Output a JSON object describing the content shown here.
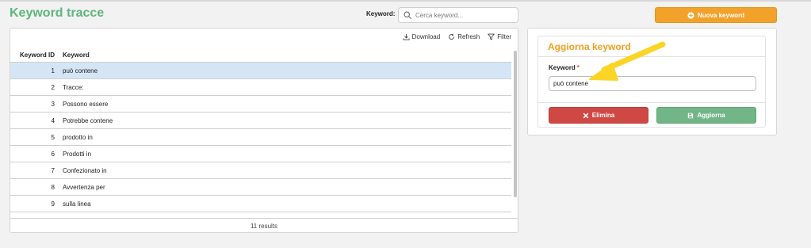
{
  "page": {
    "title": "Keyword tracce"
  },
  "search": {
    "label": "Keyword:",
    "placeholder": "Cerca keyword...",
    "value": ""
  },
  "toolbar": {
    "download_label": "Download",
    "refresh_label": "Refresh",
    "filter_label": "Filter"
  },
  "table": {
    "columns": [
      "Keyword ID",
      "Keyword"
    ],
    "selected_id": 1,
    "rows": [
      {
        "id": "1",
        "keyword": "può contene"
      },
      {
        "id": "2",
        "keyword": "Tracce:"
      },
      {
        "id": "3",
        "keyword": "Possono essere"
      },
      {
        "id": "4",
        "keyword": "Potrebbe contene"
      },
      {
        "id": "5",
        "keyword": "prodotto in"
      },
      {
        "id": "6",
        "keyword": "Prodotti in"
      },
      {
        "id": "7",
        "keyword": "Confezionato in"
      },
      {
        "id": "8",
        "keyword": "Avvertenza per"
      },
      {
        "id": "9",
        "keyword": "sulla linea"
      }
    ],
    "footer": "11 results"
  },
  "new_button": {
    "label": "Nuova keyword"
  },
  "form": {
    "title": "Aggiorna keyword",
    "field_label": "Keyword",
    "required_mark": "*",
    "field_value": "può contene",
    "delete_label": "Elimina",
    "update_label": "Aggiorna"
  },
  "colors": {
    "title_green": "#5db77c",
    "accent_orange": "#f2a12a",
    "selected_row": "#d4e6f5",
    "delete_red": "#cf4844",
    "update_green": "#72b688",
    "annotation_arrow": "#fbd426"
  },
  "icons": {
    "search": "search-icon",
    "download": "download-icon",
    "refresh": "refresh-icon",
    "filter": "filter-icon",
    "new": "plus-circle-icon",
    "delete": "close-icon",
    "update": "save-icon"
  }
}
